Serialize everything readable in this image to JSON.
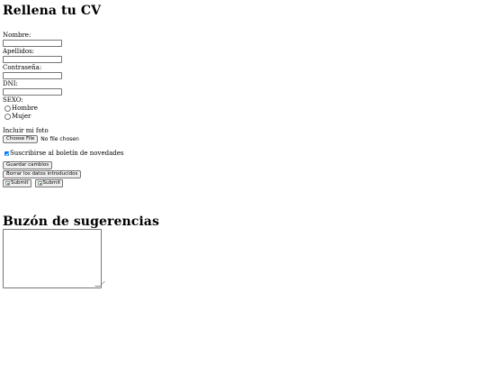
{
  "cv_form": {
    "title": "Rellena tu CV",
    "nombre_label": "Nombre:",
    "apellidos_label": "Apellidos:",
    "contrasena_label": "Contraseña:",
    "dni_label": "DNI:",
    "sexo_label": "SEXO:",
    "sexo_options": [
      "Hombre",
      "Mujer"
    ],
    "foto_label": "Incluir mi foto",
    "file_button_label": "Choose File",
    "file_status": "No file chosen",
    "newsletter_label": "Suscribirse al boletín de novedades",
    "newsletter_checked": true,
    "save_button_label": "Guardar cambios",
    "reset_button_label": "Borrar los datos introducidos",
    "image_submit_labels": [
      "Submit",
      "Submit"
    ]
  },
  "suggestions": {
    "title": "Buzón de sugerencias"
  },
  "colors": {
    "checkbox_checked": "#0075ff",
    "input_border": "#767676",
    "button_background": "#efefef"
  }
}
